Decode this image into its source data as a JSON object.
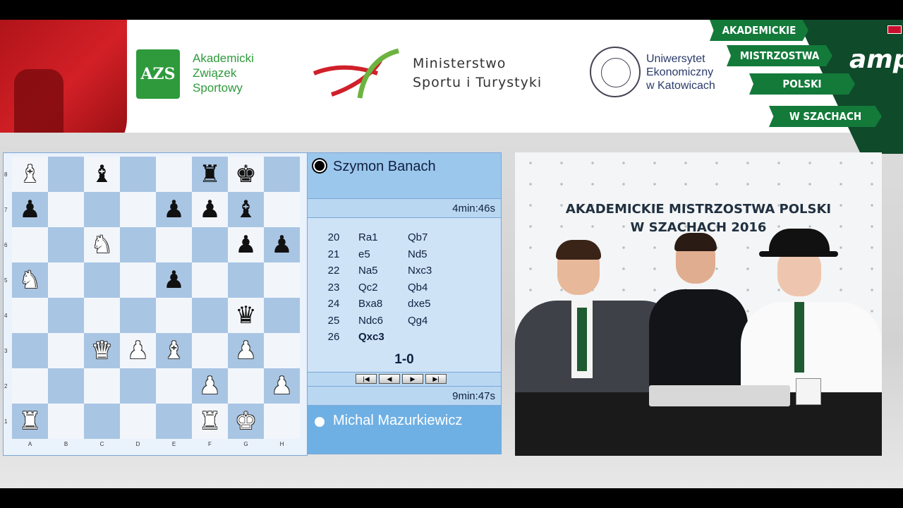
{
  "sponsors": {
    "azs": {
      "mark": "AZS",
      "lines": [
        "Akademicki",
        "Związek",
        "Sportowy"
      ]
    },
    "ministry": {
      "lines": [
        "Ministerstwo",
        "Sportu i Turystyki"
      ]
    },
    "university": {
      "lines": [
        "Uniwersytet",
        "Ekonomiczny",
        "w Katowicach"
      ]
    },
    "event_ribbons": [
      "AKADEMICKIE",
      "MISTRZOSTWA",
      "POLSKI",
      "W SZACHACH"
    ],
    "event_mark": "amp"
  },
  "board": {
    "ranks": [
      "8",
      "7",
      "6",
      "5",
      "4",
      "3",
      "2",
      "1"
    ],
    "files": [
      "A",
      "B",
      "C",
      "D",
      "E",
      "F",
      "G",
      "H"
    ],
    "position": [
      [
        "wB",
        "",
        "bB",
        "",
        "",
        "bR",
        "bK",
        ""
      ],
      [
        "bP",
        "",
        "",
        "",
        "bP",
        "bP",
        "bB",
        ""
      ],
      [
        "",
        "",
        "wN",
        "",
        "",
        "",
        "bP",
        "bP"
      ],
      [
        "wN",
        "",
        "",
        "",
        "bP",
        "",
        "",
        ""
      ],
      [
        "",
        "",
        "",
        "",
        "",
        "",
        "bQ",
        ""
      ],
      [
        "",
        "",
        "wQ",
        "wP",
        "wB",
        "",
        "wP",
        ""
      ],
      [
        "",
        "",
        "",
        "",
        "",
        "wP",
        "",
        "wP"
      ],
      [
        "wR",
        "",
        "",
        "",
        "",
        "wR",
        "wK",
        ""
      ]
    ]
  },
  "players": {
    "black": {
      "name": "Szymon Banach",
      "clock": "4min:46s"
    },
    "white": {
      "name": "Michal Mazurkiewicz",
      "clock": "9min:47s"
    }
  },
  "moves": [
    {
      "n": "20",
      "w": "Ra1",
      "b": "Qb7"
    },
    {
      "n": "21",
      "w": "e5",
      "b": "Nd5"
    },
    {
      "n": "22",
      "w": "Na5",
      "b": "Nxc3"
    },
    {
      "n": "23",
      "w": "Qc2",
      "b": "Qb4"
    },
    {
      "n": "24",
      "w": "Bxa8",
      "b": "dxe5"
    },
    {
      "n": "25",
      "w": "Ndc6",
      "b": "Qg4"
    },
    {
      "n": "26",
      "w": "Qxc3",
      "b": ""
    }
  ],
  "result": "1-0",
  "nav_buttons": [
    "first-icon",
    "prev-icon",
    "next-icon",
    "last-icon"
  ],
  "video": {
    "backdrop_title": [
      "AKADEMICKIE MISTRZOSTWA POLSKI",
      "W SZACHACH 2016"
    ]
  }
}
